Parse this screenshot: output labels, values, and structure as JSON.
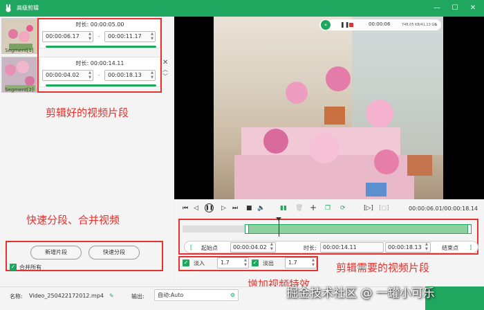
{
  "window": {
    "title": "高级剪辑",
    "minimize": "—",
    "maximize": "☐",
    "close": "✕",
    "logo_icon": "rabbit-logo-icon"
  },
  "segments": [
    {
      "label": "Segment[1]",
      "duration_label": "时长:",
      "duration": "00:00:05.00",
      "start": "00:00:06.17",
      "end": "00:00:11.17"
    },
    {
      "label": "Segment[2]",
      "duration_label": "时长:",
      "duration": "00:00:14.11",
      "start": "00:00:04.02",
      "end": "00:00:18.13"
    }
  ],
  "dash": "-",
  "annotations": {
    "clips": "剪辑好的视频片段",
    "split_merge": "快速分段、合并视频",
    "needed_clip": "剪辑需要的视频片段",
    "effects": "增加视频特效"
  },
  "buttons": {
    "new_segment": "新增片段",
    "quick_split": "快速分段"
  },
  "merge_all": {
    "label": "合并所有",
    "checked": true
  },
  "overlay": {
    "time": "00:00:06",
    "size": "748.05 KB/41.13 GB"
  },
  "player": {
    "timecode": "00:00:06.01/00:00:18.14"
  },
  "range": {
    "start_label": "起始点",
    "start": "00:00:04.02",
    "duration_label": "时长:",
    "duration": "00:00:14.11",
    "end": "00:00:18.13",
    "end_label": "结束点"
  },
  "fade": {
    "in_label": "淡入",
    "in_value": "1.7",
    "out_label": "淡出",
    "out_value": "1.7"
  },
  "bottom": {
    "name_label": "名称:",
    "filename": "Video_250422172012.mp4",
    "output_label": "输出:",
    "output_value": "自动:Auto"
  },
  "watermark": "掘金技术社区 @ 一罐小可乐",
  "accent": "#1fa65f",
  "annotation_color": "#e5322e"
}
